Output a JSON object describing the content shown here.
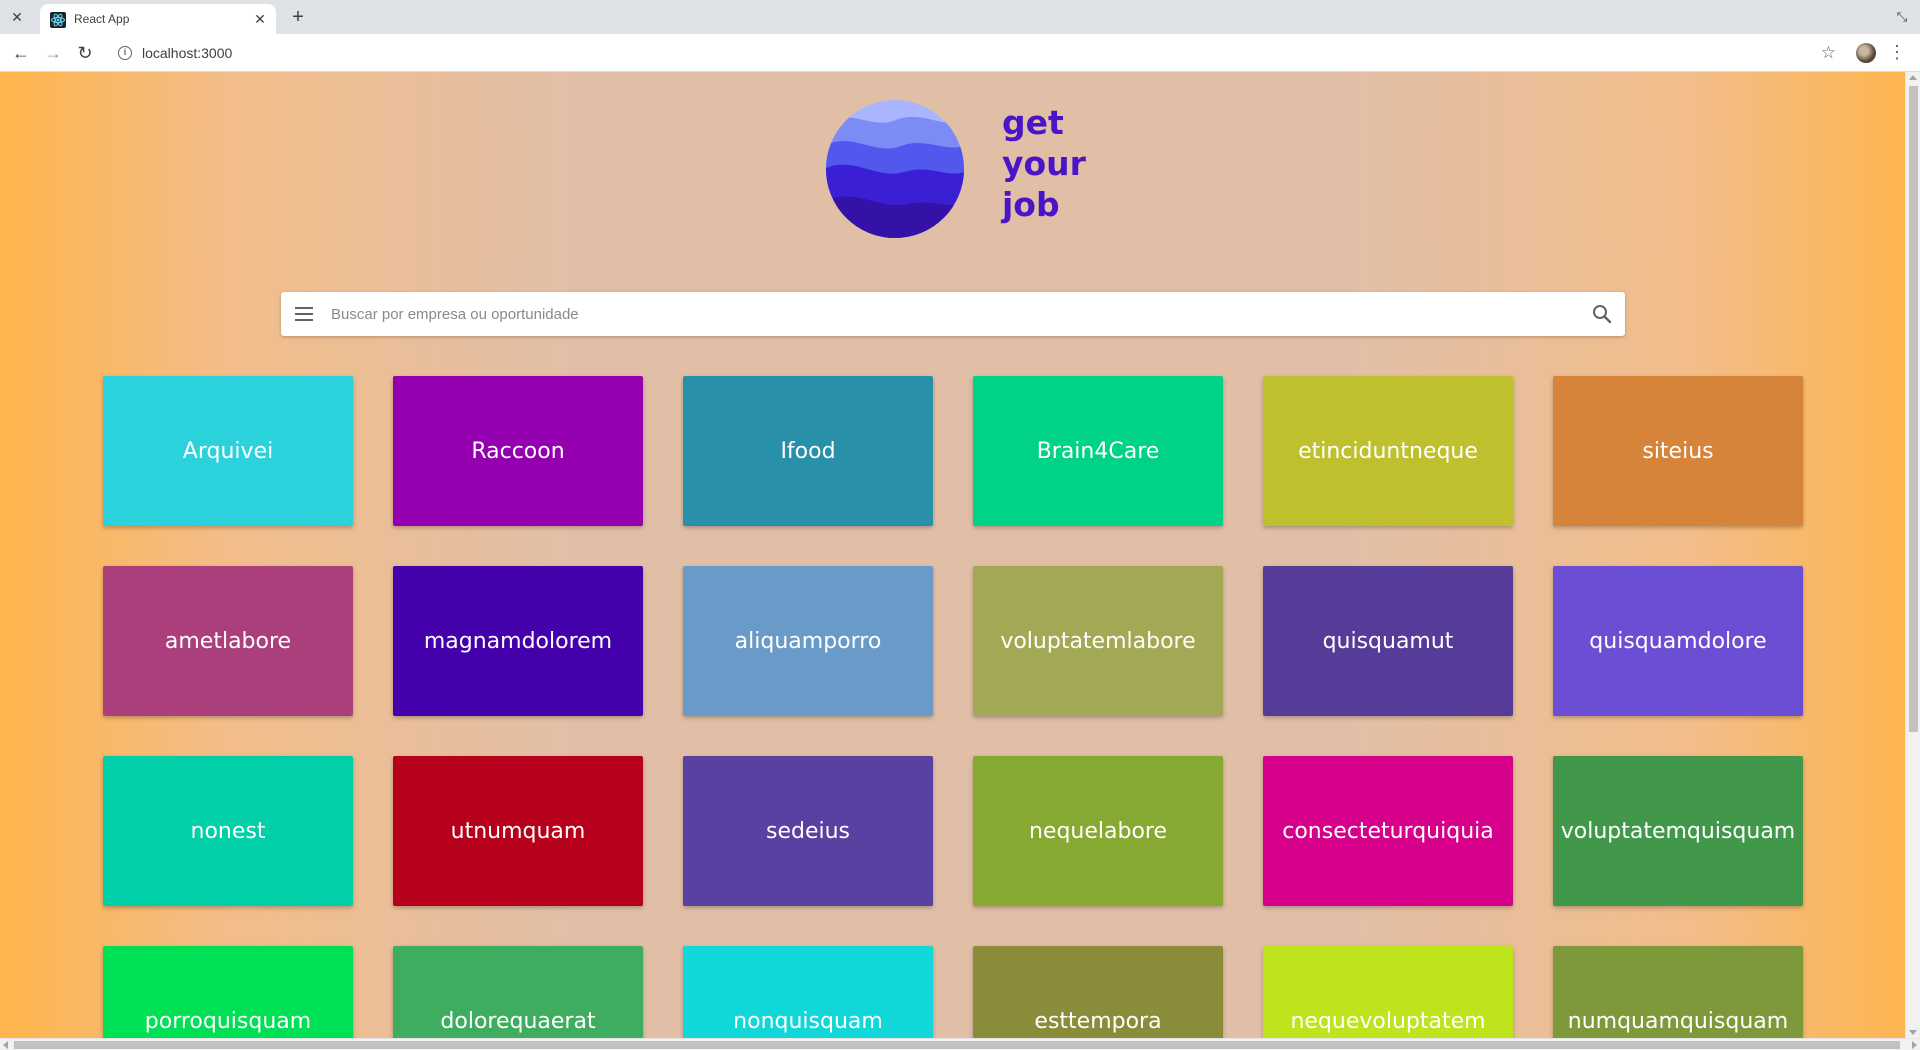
{
  "browser": {
    "tab_title": "React App",
    "url": "localhost:3000",
    "icons": {
      "tab_close": "close-icon",
      "new_tab": "plus-icon",
      "back": "arrow-left-icon",
      "forward": "arrow-right-icon",
      "reload": "reload-icon",
      "site_info": "info-icon",
      "bookmark": "star-icon",
      "profile": "avatar",
      "menu": "three-dots-icon"
    }
  },
  "app": {
    "brand": {
      "line1": "get",
      "line2": "your",
      "line3": "job",
      "color": "#4a14c8"
    },
    "search": {
      "placeholder": "Buscar por empresa ou oportunidade",
      "value": ""
    },
    "companies": [
      {
        "name": "Arquivei",
        "color": "#2bd2dc"
      },
      {
        "name": "Raccoon",
        "color": "#9400b0"
      },
      {
        "name": "Ifood",
        "color": "#2890a8"
      },
      {
        "name": "Brain4Care",
        "color": "#00d287"
      },
      {
        "name": "etinciduntneque",
        "color": "#bec02e"
      },
      {
        "name": "siteius",
        "color": "#d6843a"
      },
      {
        "name": "ametlabore",
        "color": "#aa3f7b"
      },
      {
        "name": "magnamdolorem",
        "color": "#4400aa"
      },
      {
        "name": "aliquamporro",
        "color": "#6a9ac8"
      },
      {
        "name": "voluptatemlabore",
        "color": "#a2a853"
      },
      {
        "name": "quisquamut",
        "color": "#563c98"
      },
      {
        "name": "quisquamdolore",
        "color": "#6c4ed5"
      },
      {
        "name": "nonest",
        "color": "#00cfa8"
      },
      {
        "name": "utnumquam",
        "color": "#b6001c"
      },
      {
        "name": "sedeius",
        "color": "#5a40a0"
      },
      {
        "name": "nequelabore",
        "color": "#86a932"
      },
      {
        "name": "consecteturquiquia",
        "color": "#d6008a"
      },
      {
        "name": "voluptatemquisquam",
        "color": "#42984a"
      },
      {
        "name": "porroquisquam",
        "color": "#00e055"
      },
      {
        "name": "dolorequaerat",
        "color": "#3ead5f"
      },
      {
        "name": "nonquisquam",
        "color": "#12d7d9"
      },
      {
        "name": "esttempora",
        "color": "#8b8c3a"
      },
      {
        "name": "nequevoluptatem",
        "color": "#bde41c"
      },
      {
        "name": "numquamquisquam",
        "color": "#7e993a"
      }
    ]
  }
}
